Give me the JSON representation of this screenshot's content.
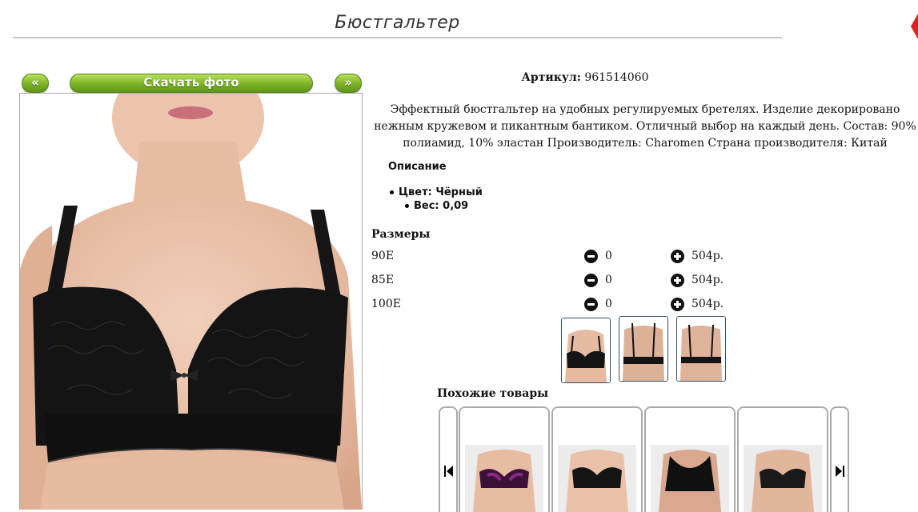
{
  "page": {
    "title": "Бюстгальтер"
  },
  "nav": {
    "prev_label": "«",
    "download_label": "Скачать фото",
    "next_label": "»"
  },
  "product": {
    "article_label": "Артикул:",
    "article_value": "961514060",
    "description": "Эффектный бюстгальтер на удобных регулируемых бретелях. Изделие декорировано нежным кружевом и пикантным бантиком. Отличный выбор на каждый день. Состав: 90% полиамид, 10% эластан Производитель: Charomen Страна производителя: Китай",
    "description_heading": "Описание",
    "attributes": [
      "Цвет: Чёрный",
      "Вес: 0,09"
    ]
  },
  "sizes": {
    "heading": "Размеры",
    "rows": [
      {
        "name": "90E",
        "qty": "0",
        "price": "504р."
      },
      {
        "name": "85E",
        "qty": "0",
        "price": "504р."
      },
      {
        "name": "100E",
        "qty": "0",
        "price": "504р."
      }
    ]
  },
  "thumbnails": [
    "front-view",
    "back-view",
    "back-view-2"
  ],
  "similar": {
    "heading": "Похожие товары",
    "items": [
      "purple-black-bra",
      "black-lace-bra",
      "black-sports-bra",
      "black-balconette-bra"
    ]
  },
  "colors": {
    "accent_green": "#7cb227",
    "bra": "#111111",
    "skin": "#e9c0a8"
  }
}
